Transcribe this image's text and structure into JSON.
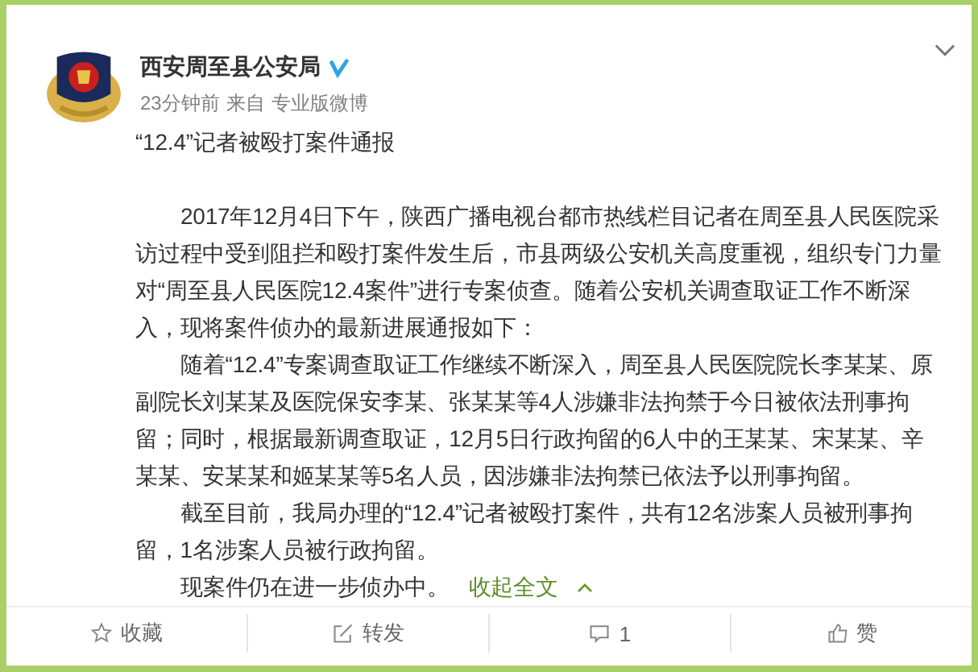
{
  "author": {
    "name": "西安周至县公安局",
    "verified": true
  },
  "meta": {
    "time": "23分钟前",
    "from": "来自",
    "source": "专业版微博"
  },
  "post": {
    "title": "“12.4”记者被殴打案件通报",
    "paragraphs": [
      "2017年12月4日下午，陕西广播电视台都市热线栏目记者在周至县人民医院采访过程中受到阻拦和殴打案件发生后，市县两级公安机关高度重视，组织专门力量对“周至县人民医院12.4案件”进行专案侦查。随着公安机关调查取证工作不断深入，现将案件侦办的最新进展通报如下：",
      "随着“12.4”专案调查取证工作继续不断深入，周至县人民医院院长李某某、原副院长刘某某及医院保安李某、张某某等4人涉嫌非法拘禁于今日被依法刑事拘留；同时，根据最新调查取证，12月5日行政拘留的6人中的王某某、宋某某、辛某某、安某某和姬某某等5名人员，因涉嫌非法拘禁已依法予以刑事拘留。",
      "截至目前，我局办理的“12.4”记者被殴打案件，共有12名涉案人员被刑事拘留，1名涉案人员被行政拘留。",
      "现案件仍在进一步侦办中。"
    ],
    "collapse_link": "收起全文"
  },
  "actions": [
    {
      "kind": "favorite",
      "label": "收藏"
    },
    {
      "kind": "repost",
      "label": "转发"
    },
    {
      "kind": "comment",
      "label": "1"
    },
    {
      "kind": "like",
      "label": "赞"
    }
  ]
}
